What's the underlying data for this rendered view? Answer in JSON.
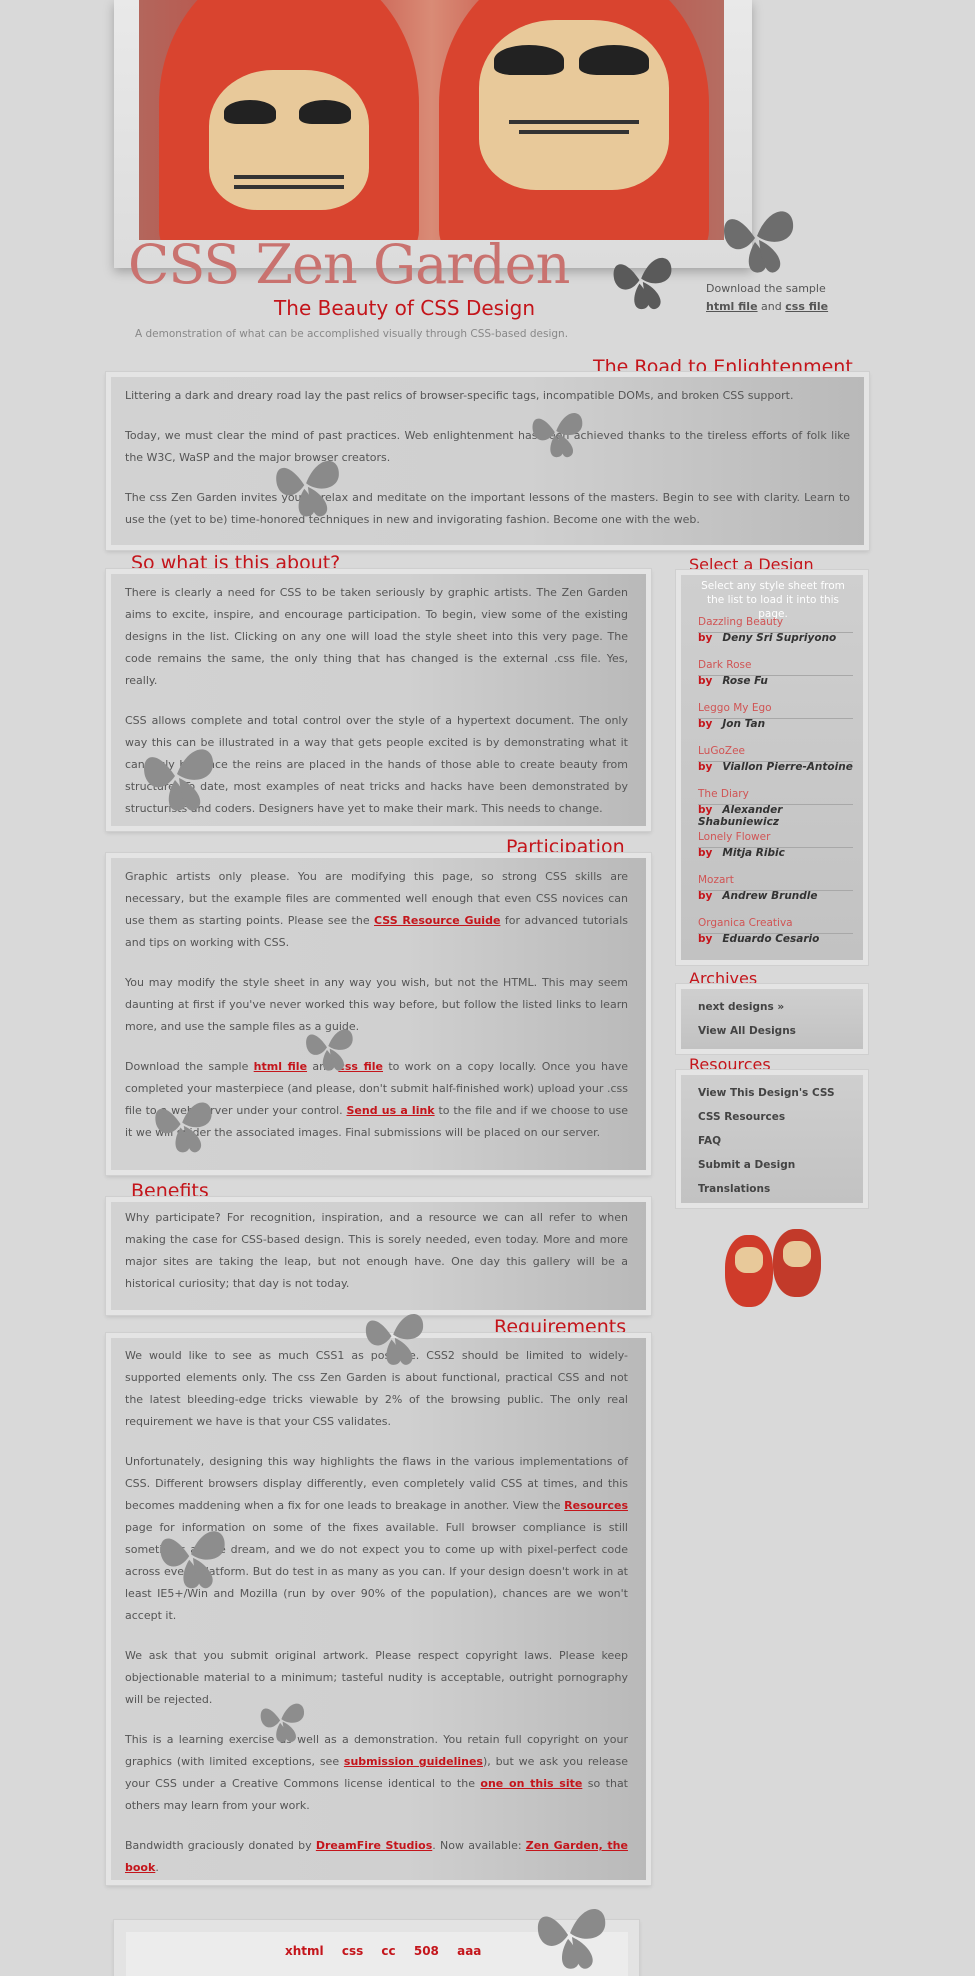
{
  "header": {
    "title": "CSS Zen Garden",
    "subtitle": "The Beauty of CSS Design",
    "tagline": "A demonstration of what can be accomplished visually through CSS-based design.",
    "download_prefix": "Download the sample",
    "download_html": "html file",
    "download_and": "and",
    "download_css": "css file"
  },
  "sections": {
    "road_title": "The Road to Enlightenment",
    "road_p1": "Littering a dark and dreary road lay the past relics of browser-specific tags, incompatible DOMs, and broken CSS support.",
    "road_p2": "Today, we must clear the mind of past practices. Web enlightenment has been achieved thanks to the tireless efforts of folk like the W3C, WaSP and the major browser creators.",
    "road_p3": "The css Zen Garden invites you to relax and meditate on the important lessons of the masters. Begin to see with clarity. Learn to use the (yet to be) time-honored techniques in new and invigorating fashion. Become one with the web.",
    "about_title": "So what is this about?",
    "about_p1": "There is clearly a need for CSS to be taken seriously by graphic artists. The Zen Garden aims to excite, inspire, and encourage participation. To begin, view some of the existing designs in the list. Clicking on any one will load the style sheet into this very page. The code remains the same, the only thing that has changed is the external .css file. Yes, really.",
    "about_p2": "CSS allows complete and total control over the style of a hypertext document. The only way this can be illustrated in a way that gets people excited is by demonstrating what it can truly be, once the reins are placed in the hands of those able to create beauty from structure. To date, most examples of neat tricks and hacks have been demonstrated by structurists and coders. Designers have yet to make their mark. This needs to change.",
    "part_title": "Participation",
    "part_p1_a": "Graphic artists only please. You are modifying this page, so strong CSS skills are necessary, but the example files are commented well enough that even CSS novices can use them as starting points. Please see the ",
    "part_p1_link": "CSS Resource Guide",
    "part_p1_b": " for advanced tutorials and tips on working with CSS.",
    "part_p2": "You may modify the style sheet in any way you wish, but not the HTML. This may seem daunting at first if you've never worked this way before, but follow the listed links to learn more, and use the sample files as a guide.",
    "part_p3_a": "Download the sample ",
    "part_p3_html": "html file",
    "part_p3_b": " and ",
    "part_p3_css": "css file",
    "part_p3_c": " to work on a copy locally. Once you have completed your masterpiece (and please, don't submit half-finished work) upload your .css file to a web server under your control. ",
    "part_p3_link": "Send us a link",
    "part_p3_d": " to the file and if we choose to use it we will spider the associated images. Final submissions will be placed on our server.",
    "benefits_title": "Benefits",
    "benefits_p1": "Why participate? For recognition, inspiration, and a resource we can all refer to when making the case for CSS-based design. This is sorely needed, even today. More and more major sites are taking the leap, but not enough have. One day this gallery will be a historical curiosity; that day is not today.",
    "req_title": "Requirements",
    "req_p1": "We would like to see as much CSS1 as possible. CSS2 should be limited to widely-supported elements only. The css Zen Garden is about functional, practical CSS and not the latest bleeding-edge tricks viewable by 2% of the browsing public. The only real requirement we have is that your CSS validates.",
    "req_p2_a": "Unfortunately, designing this way highlights the flaws in the various implementations of CSS. Different browsers display differently, even completely valid CSS at times, and this becomes maddening when a fix for one leads to breakage in another. View the ",
    "req_p2_link": "Resources",
    "req_p2_b": " page for information on some of the fixes available. Full browser compliance is still sometimes a pipe dream, and we do not expect you to come up with pixel-perfect code across every platform. But do test in as many as you can. If your design doesn't work in at least IE5+/Win and Mozilla (run by over 90% of the population), chances are we won't accept it.",
    "req_p3": "We ask that you submit original artwork. Please respect copyright laws. Please keep objectionable material to a minimum; tasteful nudity is acceptable, outright pornography will be rejected.",
    "req_p4_a": "This is a learning exercise as well as a demonstration. You retain full copyright on your graphics (with limited exceptions, see ",
    "req_p4_link1": "submission guidelines",
    "req_p4_b": "), but we ask you release your CSS under a Creative Commons license identical to the ",
    "req_p4_link2": "one on this site",
    "req_p4_c": " so that others may learn from your work.",
    "req_p5_a": "Bandwidth graciously donated by ",
    "req_p5_link1": "DreamFire Studios",
    "req_p5_b": ". Now available: ",
    "req_p5_link2": "Zen Garden, the book",
    "req_p5_c": "."
  },
  "sidebar": {
    "select_title": "Select a Design",
    "select_intro": "Select any style sheet from the list to load it into this page.",
    "by_word": "by",
    "designs": [
      {
        "name": "Dazzling Beauty",
        "author": "Deny Sri Supriyono"
      },
      {
        "name": "Dark Rose",
        "author": "Rose Fu"
      },
      {
        "name": "Leggo My Ego",
        "author": "Jon Tan"
      },
      {
        "name": "LuGoZee",
        "author": "Viallon Pierre-Antoine"
      },
      {
        "name": "The Diary",
        "author": "Alexander Shabuniewicz"
      },
      {
        "name": "Lonely Flower",
        "author": "Mitja Ribic"
      },
      {
        "name": "Mozart",
        "author": "Andrew Brundle"
      },
      {
        "name": "Organica Creativa",
        "author": "Eduardo Cesario"
      }
    ],
    "archives_title": "Archives",
    "archives_next": "next designs »",
    "archives_all": "View All Designs",
    "resources_title": "Resources",
    "resources": [
      "View This Design's CSS",
      "CSS Resources",
      "FAQ",
      "Submit a Design",
      "Translations"
    ]
  },
  "footer": {
    "links": [
      "xhtml",
      "css",
      "cc",
      "508",
      "aaa"
    ]
  },
  "colors": {
    "accent_red": "#c4151b",
    "background": "#d9d9d9",
    "panel": "#d0d0d0"
  },
  "icons": [
    "butterfly-icon"
  ]
}
